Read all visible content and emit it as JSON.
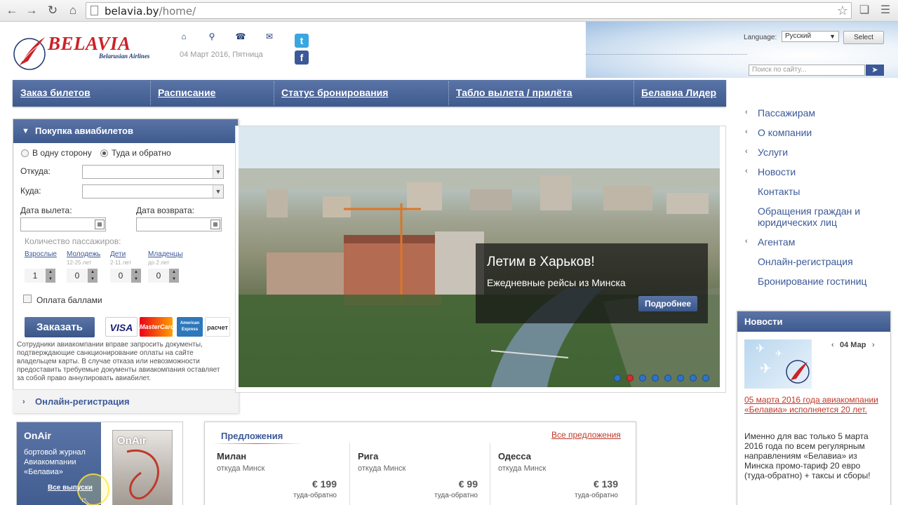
{
  "browser": {
    "url_host": "belavia.by",
    "url_path": "/home/"
  },
  "header": {
    "logo_text": "BELAVIA",
    "logo_sub": "Belarusian Airlines",
    "date": "04 Март 2016, Пятница",
    "language_label": "Language:",
    "language_value": "Русский",
    "select_button": "Select",
    "search_placeholder": "Поиск по сайту..."
  },
  "mainnav": {
    "items": [
      "Заказ билетов",
      "Расписание",
      "Статус бронирования",
      "Табло вылета / прилёта",
      "Белавиа Лидер"
    ]
  },
  "booking": {
    "title": "Покупка авиабилетов",
    "one_way": "В одну сторону",
    "round_trip": "Туда и обратно",
    "trip_type_selected": "round_trip",
    "from_label": "Откуда:",
    "to_label": "Куда:",
    "departure_label": "Дата вылета:",
    "return_label": "Дата возврата:",
    "passengers_title": "Количество пассажиров:",
    "passengers": [
      {
        "label": "Взрослые",
        "sub": "",
        "value": "1"
      },
      {
        "label": "Молодежь",
        "sub": "12-25 лет",
        "value": "0"
      },
      {
        "label": "Дети",
        "sub": "2-11 лет",
        "value": "0"
      },
      {
        "label": "Младенцы",
        "sub": "до 2 лет",
        "value": "0"
      }
    ],
    "pay_points": "Оплата баллами",
    "order_button": "Заказать",
    "cards": [
      "VISA",
      "MasterCard",
      "American Express",
      "расчет"
    ],
    "disclaimer": "Сотрудники авиакомпании вправе запросить документы, подтверждающие санкционирование оплаты на сайте владельцем карты. В случае отказа или невозможности предоставить требуемые документы авиакомпания оставляет за собой право аннулировать авиабилет.",
    "online_registration": "Онлайн-регистрация"
  },
  "banner": {
    "title": "Летим в Харьков!",
    "subtitle": "Ежедневные рейсы из Минска",
    "more_button": "Подробнее",
    "slide_count": 8,
    "active_slide": 2
  },
  "right_nav": {
    "items": [
      {
        "label": "Пассажирам",
        "chevron": true
      },
      {
        "label": "О компании",
        "chevron": true
      },
      {
        "label": "Услуги",
        "chevron": true
      },
      {
        "label": "Новости",
        "chevron": true
      },
      {
        "label": "Контакты",
        "chevron": false
      },
      {
        "label": "Обращения граждан и юридических лиц",
        "chevron": false
      },
      {
        "label": "Агентам",
        "chevron": true
      },
      {
        "label": "Онлайн-регистрация",
        "chevron": false
      },
      {
        "label": "Бронирование гостиниц",
        "chevron": false
      }
    ]
  },
  "news": {
    "title": "Новости",
    "date": "04 Мар",
    "headline": "05 марта 2016 года авиакомпании «Белавиа» исполняется 20 лет.",
    "text": "Именно для вас только 5 марта 2016 года по всем регулярным направлениям «Белавиа» из Минска промо-тариф 20 евро (туда-обратно) + таксы и сборы!"
  },
  "onair": {
    "title": "OnAir",
    "text": "бортовой журнал Авиакомпании «Белавиа»",
    "all_issues": "Все выпуски",
    "magazine_title": "OnAir"
  },
  "offers": {
    "title": "Предложения",
    "all_link": "Все предложения",
    "items": [
      {
        "city": "Милан",
        "from": "откуда Минск",
        "price": "€ 199",
        "type": "туда-обратно"
      },
      {
        "city": "Рига",
        "from": "откуда Минск",
        "price": "€ 99",
        "type": "туда-обратно"
      },
      {
        "city": "Одесса",
        "from": "откуда Минск",
        "price": "€ 139",
        "type": "туда-обратно"
      }
    ]
  },
  "colors": {
    "brand_blue": "#3f5a8e",
    "brand_red": "#cc2229",
    "link_red": "#c0392b"
  }
}
